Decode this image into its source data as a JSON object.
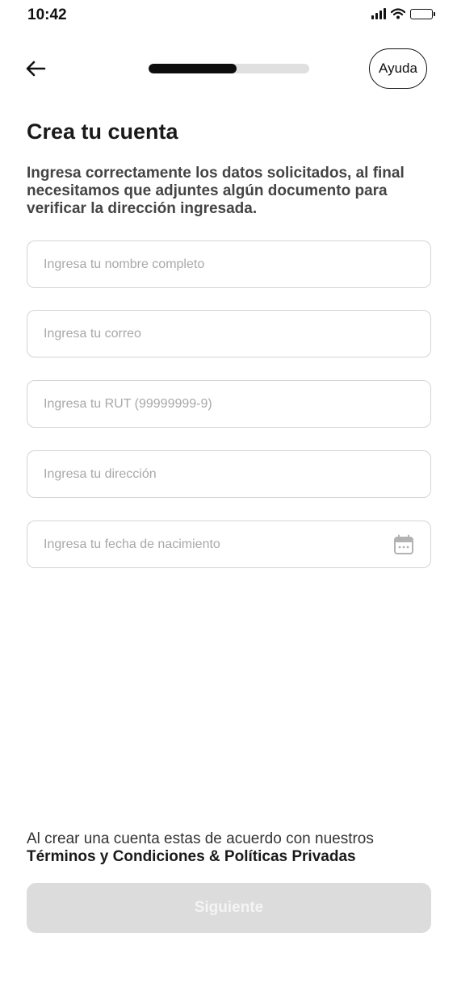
{
  "status_bar": {
    "time": "10:42",
    "icons": [
      "signal-icon",
      "wifi-icon",
      "battery-icon"
    ]
  },
  "header": {
    "back_icon": "arrow-left-icon",
    "progress_fraction": 0.55,
    "help_label": "Ayuda"
  },
  "main": {
    "title": "Crea tu cuenta",
    "description": "Ingresa correctamente los datos solicitados, al final necesitamos que adjuntes algún documento para verificar la dirección ingresada.",
    "fields": [
      {
        "placeholder": "Ingresa tu nombre completo",
        "value": ""
      },
      {
        "placeholder": "Ingresa tu correo",
        "value": ""
      },
      {
        "placeholder": "Ingresa tu RUT (99999999-9)",
        "value": ""
      },
      {
        "placeholder": "Ingresa tu dirección",
        "value": ""
      },
      {
        "placeholder": "Ingresa tu fecha de nacimiento",
        "value": "",
        "icon": "calendar-icon"
      }
    ]
  },
  "footer": {
    "terms_intro": "Al crear una cuenta estas de acuerdo con nuestros",
    "terms_link": "Términos y Condiciones & Políticas Privadas",
    "next_label": "Siguiente",
    "next_enabled": false
  },
  "colors": {
    "primary": "#0d0d0d",
    "progress_track": "#e0e0e0",
    "field_border": "#d4d4d4",
    "placeholder": "#a8a8a8",
    "button_disabled_bg": "#dcdcdc",
    "button_disabled_text": "#f4f4f4"
  }
}
